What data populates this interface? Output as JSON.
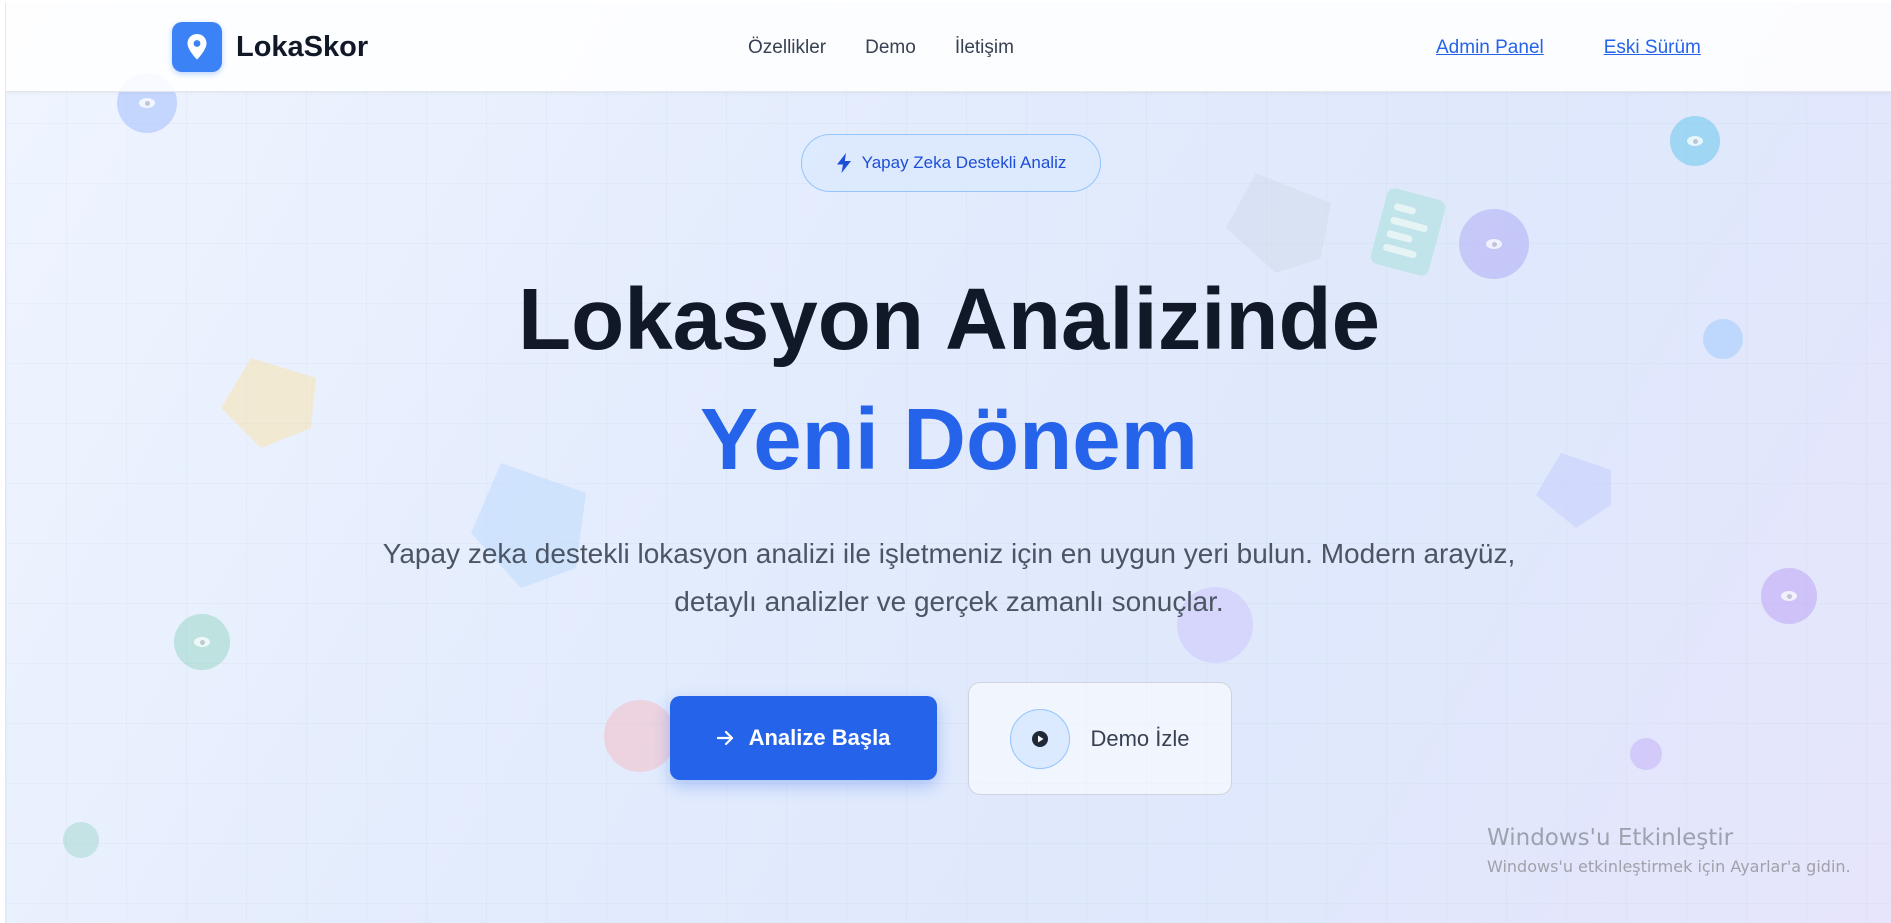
{
  "brand": {
    "name": "LokaSkor",
    "icon": "map-pin-icon",
    "color": "#3b82f6"
  },
  "nav": {
    "items": [
      {
        "label": "Özellikler"
      },
      {
        "label": "Demo"
      },
      {
        "label": "İletişim"
      }
    ],
    "links": [
      {
        "label": "Admin Panel"
      },
      {
        "label": "Eski Sürüm"
      }
    ]
  },
  "hero": {
    "badge": {
      "icon": "lightning-icon",
      "label": "Yapay Zeka Destekli Analiz"
    },
    "title_line1": "Lokasyon Analizinde",
    "title_line2": "Yeni Dönem",
    "subtitle_line1": "Yapay zeka destekli lokasyon analizi ile işletmeniz için en uygun yeri bulun. Modern arayüz,",
    "subtitle_line2": "detaylı analizler ve gerçek zamanlı sonuçlar.",
    "primary_button": {
      "icon": "arrow-right-icon",
      "label": "Analize Başla"
    },
    "secondary_button": {
      "icon": "play-icon",
      "label": "Demo İzle"
    }
  },
  "watermark": {
    "title": "Windows'u Etkinleştir",
    "subtitle": "Windows'u etkinleştirmek için Ayarlar'a gidin."
  },
  "colors": {
    "accent": "#2563eb",
    "title": "#111827",
    "text": "#4b5563"
  }
}
